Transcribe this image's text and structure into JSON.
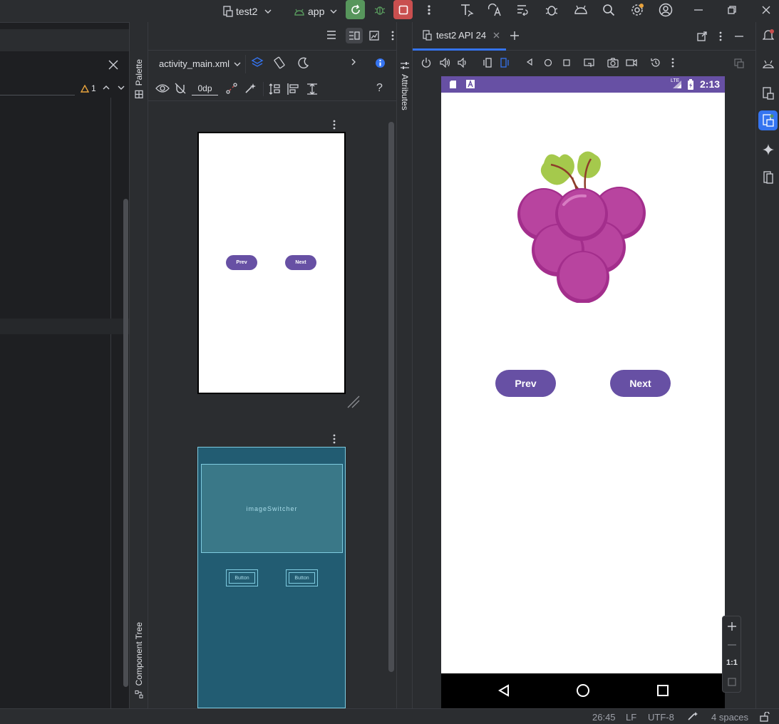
{
  "titlebar": {
    "run_config": "test2",
    "module": "app"
  },
  "left_panel": {
    "warning_count": "1"
  },
  "palette_strip": {
    "palette_label": "Palette",
    "component_tree_label": "Component Tree"
  },
  "design": {
    "file_name": "activity_main.xml",
    "margin_value": "0dp",
    "help": "?",
    "design_prev": "Prev",
    "design_next": "Next",
    "blueprint_image": "imageSwitcher",
    "blueprint_button1": "Button",
    "blueprint_button2": "Button"
  },
  "attributes_strip": {
    "label": "Attributes"
  },
  "devices": {
    "tab_label": "test2 API 24",
    "status_time": "2:13",
    "status_network": "LTE",
    "prev_label": "Prev",
    "next_label": "Next",
    "zoom_ratio": "1:1"
  },
  "statusbar": {
    "position": "26:45",
    "line_sep": "LF",
    "encoding": "UTF-8",
    "indent": "4 spaces"
  },
  "colors": {
    "accent": "#3574f0",
    "phone_status": "#6750a4",
    "button": "#6750a4",
    "run_green": "#57965c",
    "stop_red": "#c94f4f",
    "blueprint_bg": "#225c72"
  }
}
